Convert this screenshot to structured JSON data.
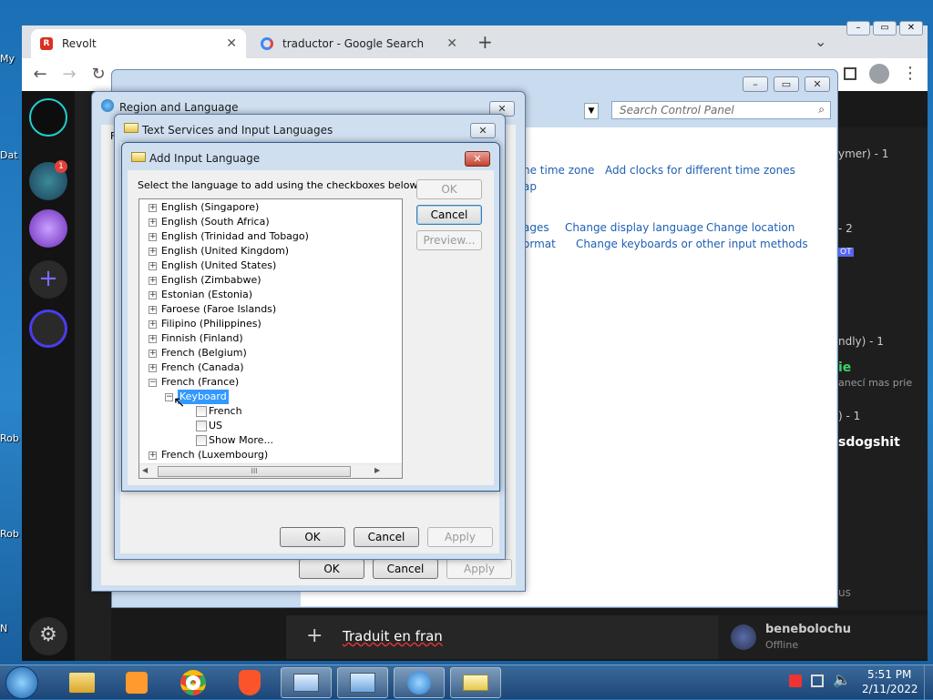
{
  "desktop": {
    "icons": [
      "My",
      "Dat",
      "Rob",
      "Rob",
      "N"
    ]
  },
  "browser": {
    "tabs": [
      {
        "label": "Revolt",
        "close": "✕"
      },
      {
        "label": "traductor - Google Search",
        "close": "✕"
      }
    ],
    "new_tab": "+",
    "tab_menu": "⌄",
    "nav": {
      "back": "←",
      "forward": "→",
      "reload": "↻"
    },
    "menu": "⋮"
  },
  "revolt": {
    "badge": "1",
    "add_server": "+",
    "settings": "⚙",
    "right_panel": [
      "ymer) - 1",
      "- 2",
      "OT",
      "ndly) - 1",
      "ie",
      "anecí mas prie",
      ") - 1",
      "sdogshit",
      "us"
    ],
    "composer": {
      "plus": "+",
      "text": "Traduit en fran"
    },
    "user": {
      "name": "benebolochu",
      "status": "Offline"
    }
  },
  "control_panel": {
    "search_placeholder": "Search Control Panel",
    "links": [
      "he time zone",
      "Add clocks for different time zones",
      "ap",
      "ages",
      "Change display language",
      "Change location",
      "ormat",
      "Change keyboards or other input methods"
    ],
    "buttons": {
      "ok": "OK",
      "cancel": "Cancel",
      "apply": "Apply"
    }
  },
  "region_dialog": {
    "title": "Region and Language",
    "close": "✕",
    "tab_stub": "F"
  },
  "tsil_dialog": {
    "title": "Text Services and Input Languages",
    "close": "✕",
    "ok": "OK",
    "cancel": "Cancel",
    "apply": "Apply"
  },
  "add_dialog": {
    "title": "Add Input Language",
    "close": "✕",
    "instruction": "Select the language to add using the checkboxes below.",
    "buttons": {
      "ok": "OK",
      "cancel": "Cancel",
      "preview": "Preview..."
    },
    "tree": [
      {
        "label": "English (Singapore)",
        "expander": "+"
      },
      {
        "label": "English (South Africa)",
        "expander": "+"
      },
      {
        "label": "English (Trinidad and Tobago)",
        "expander": "+"
      },
      {
        "label": "English (United Kingdom)",
        "expander": "+"
      },
      {
        "label": "English (United States)",
        "expander": "+"
      },
      {
        "label": "English (Zimbabwe)",
        "expander": "+"
      },
      {
        "label": "Estonian (Estonia)",
        "expander": "+"
      },
      {
        "label": "Faroese (Faroe Islands)",
        "expander": "+"
      },
      {
        "label": "Filipino (Philippines)",
        "expander": "+"
      },
      {
        "label": "Finnish (Finland)",
        "expander": "+"
      },
      {
        "label": "French (Belgium)",
        "expander": "+"
      },
      {
        "label": "French (Canada)",
        "expander": "+"
      },
      {
        "label": "French (France)",
        "expander": "−"
      }
    ],
    "keyboard_node": {
      "label": "Keyboard",
      "expander": "−"
    },
    "keyboards": [
      "French",
      "US",
      "Show More..."
    ],
    "after": {
      "label": "French (Luxembourg)",
      "expander": "+"
    },
    "hscroll_grip": "III"
  },
  "clock": {
    "time": "5:51 PM",
    "date": "2/11/2022"
  }
}
